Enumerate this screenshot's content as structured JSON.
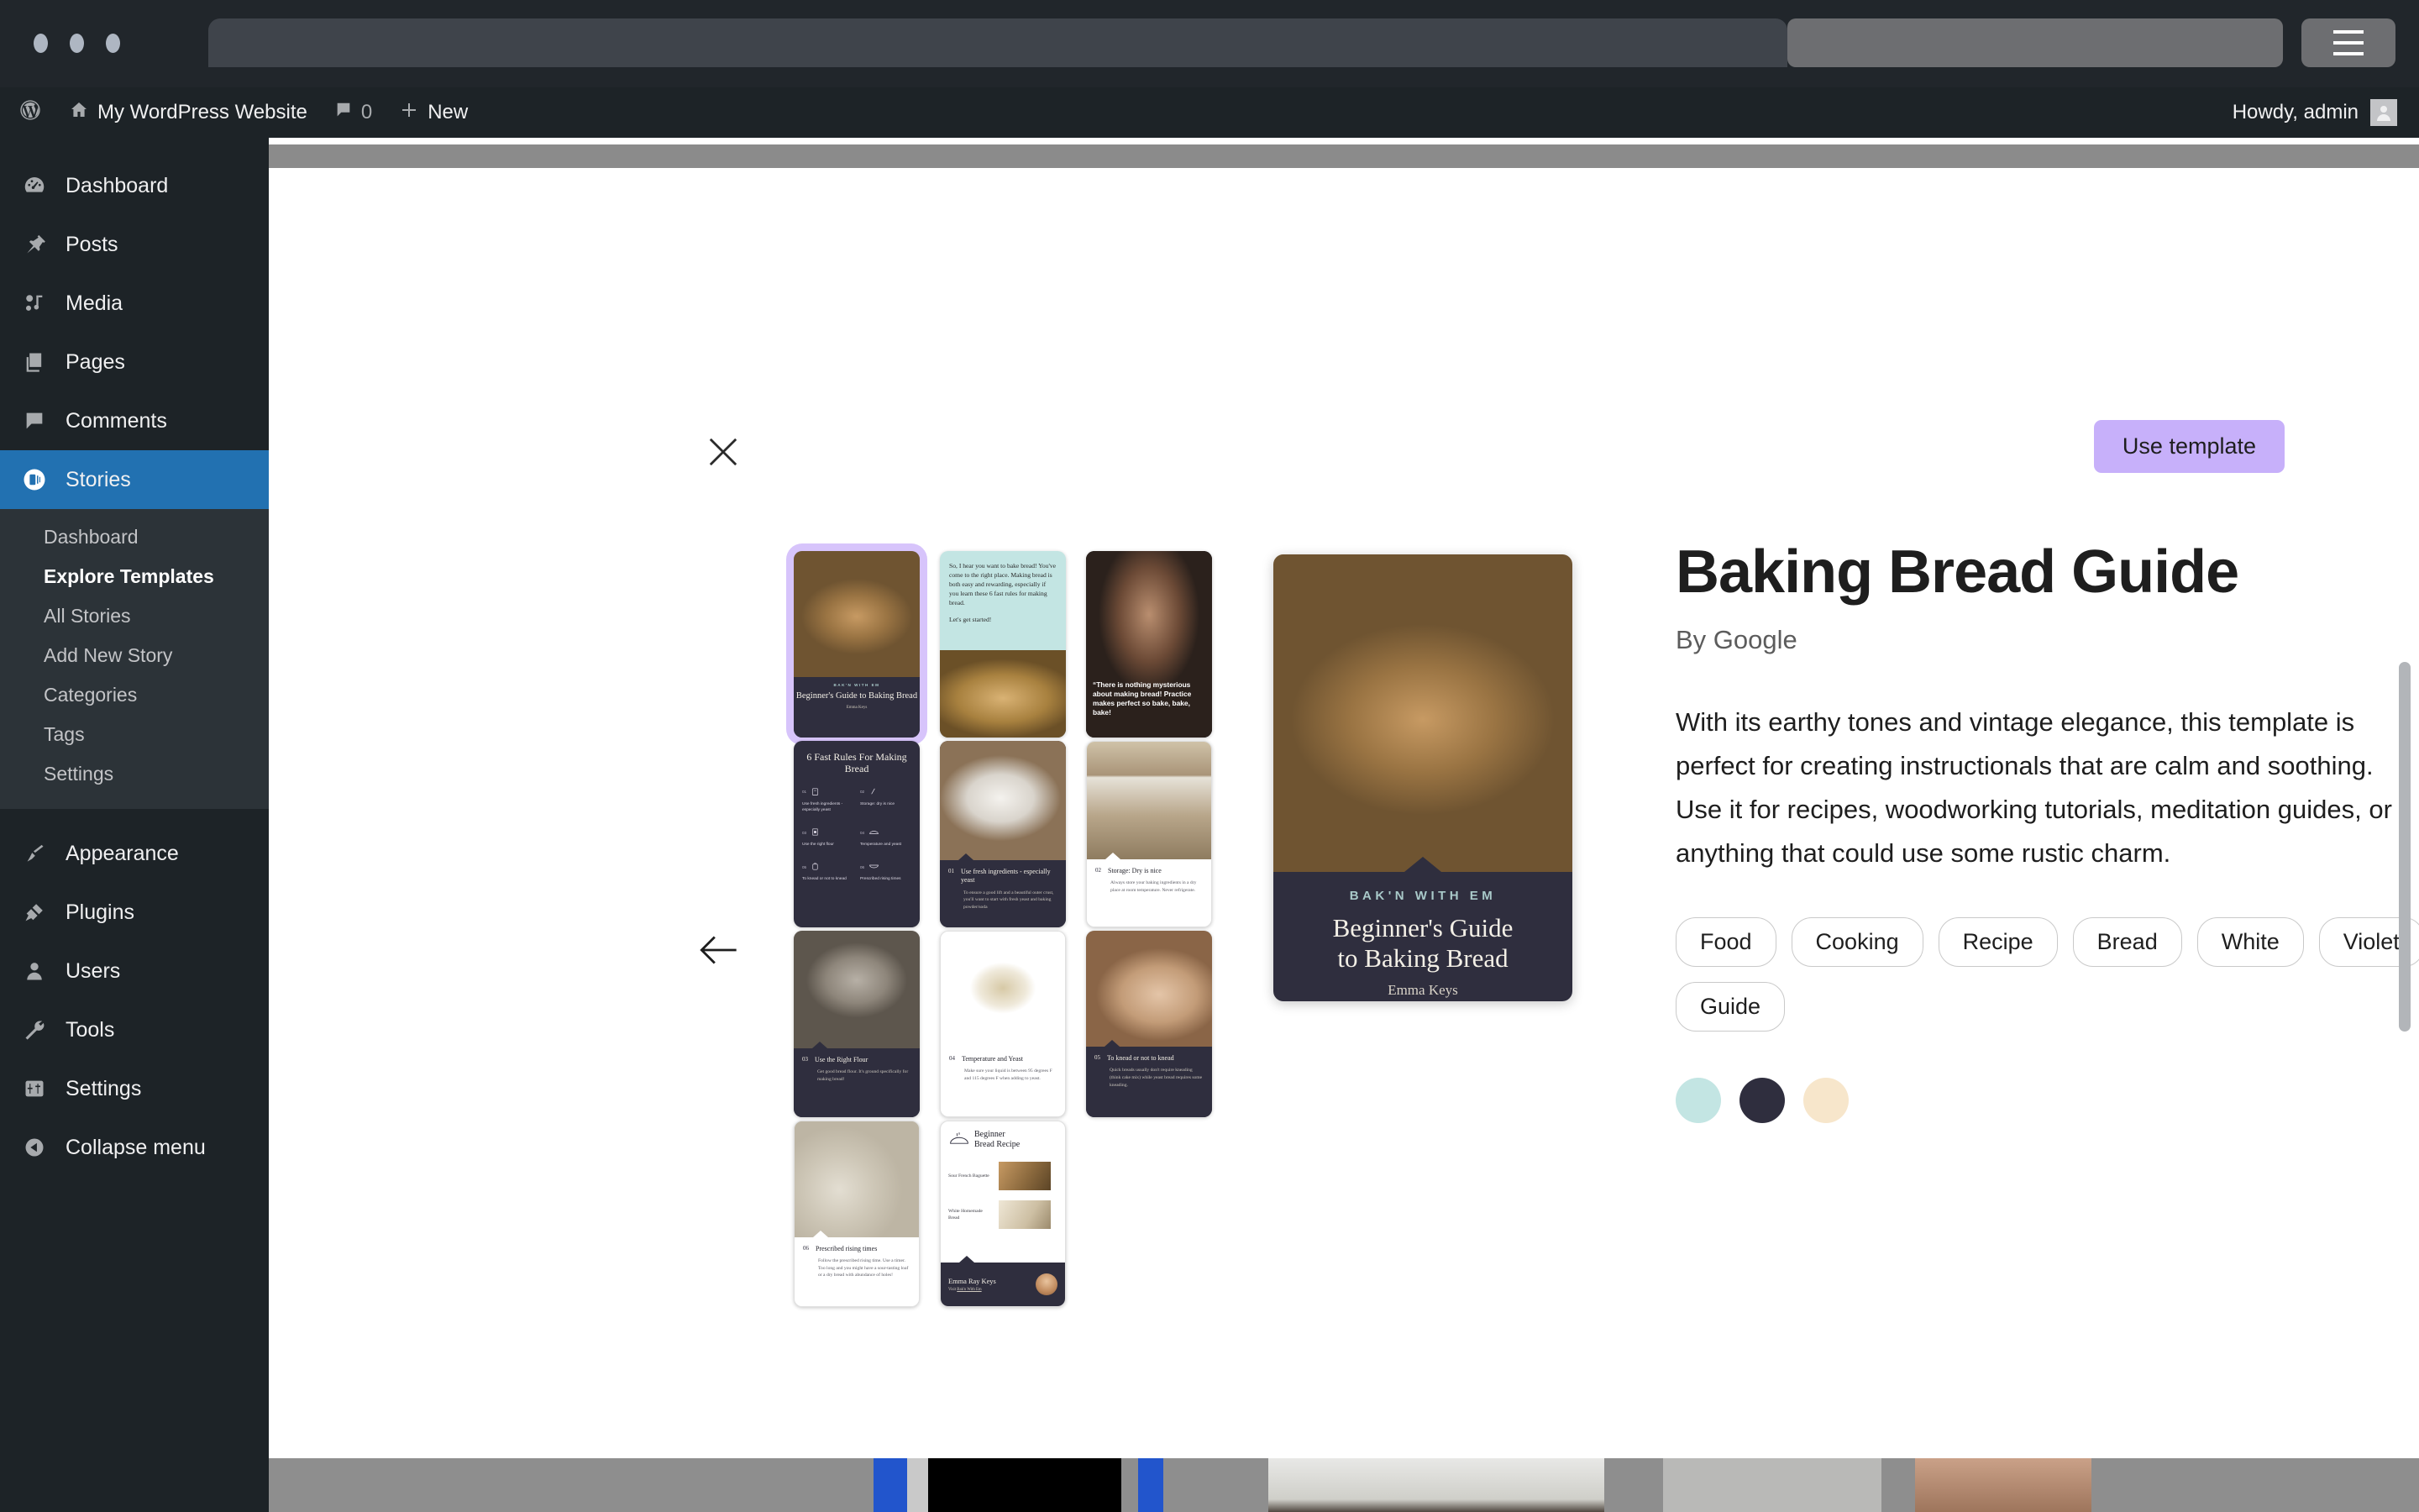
{
  "browser": {
    "traffic_lights": [
      "close",
      "minimize",
      "maximize"
    ],
    "url_value": "",
    "url_placeholder": "",
    "search_value": "",
    "menu_icon": "hamburger-icon"
  },
  "adminbar": {
    "logo": "wordpress-logo-icon",
    "site_icon": "home-icon",
    "site_name": "My WordPress Website",
    "comments_icon": "comment-bubble-icon",
    "comments_count": "0",
    "new_icon": "plus-icon",
    "new_label": "New",
    "howdy": "Howdy, admin",
    "avatar": "user-avatar-icon"
  },
  "sidebar": {
    "items": [
      {
        "label": "Dashboard",
        "icon": "dashboard-icon",
        "current": false
      },
      {
        "label": "Posts",
        "icon": "pin-icon",
        "current": false
      },
      {
        "label": "Media",
        "icon": "media-icon",
        "current": false
      },
      {
        "label": "Pages",
        "icon": "pages-icon",
        "current": false
      },
      {
        "label": "Comments",
        "icon": "comment-icon",
        "current": false
      },
      {
        "label": "Stories",
        "icon": "stories-icon",
        "current": true
      }
    ],
    "submenu": [
      {
        "label": "Dashboard",
        "active": false
      },
      {
        "label": "Explore Templates",
        "active": true
      },
      {
        "label": "All Stories",
        "active": false
      },
      {
        "label": "Add New Story",
        "active": false
      },
      {
        "label": "Categories",
        "active": false
      },
      {
        "label": "Tags",
        "active": false
      },
      {
        "label": "Settings",
        "active": false
      }
    ],
    "items_bottom": [
      {
        "label": "Appearance",
        "icon": "paintbrush-icon"
      },
      {
        "label": "Plugins",
        "icon": "plug-icon"
      },
      {
        "label": "Users",
        "icon": "user-icon"
      },
      {
        "label": "Tools",
        "icon": "wrench-icon"
      },
      {
        "label": "Settings",
        "icon": "settings-sliders-icon"
      },
      {
        "label": "Collapse menu",
        "icon": "collapse-arrow-icon"
      }
    ]
  },
  "modal": {
    "close_icon": "close-x-icon",
    "use_template_label": "Use template",
    "prev_icon": "arrow-left-icon",
    "next_icon": "arrow-right-icon",
    "accent_color": "#c7b0fa"
  },
  "template": {
    "title": "Baking Bread Guide",
    "byline": "By Google",
    "description": "With its earthy tones and vintage elegance, this template is perfect for creating instructionals that are calm and soothing. Use it for recipes, woodworking tutorials, meditation guides, or anything that could use some rustic charm.",
    "tags": [
      "Food",
      "Cooking",
      "Recipe",
      "Bread",
      "White",
      "Violet",
      "Guide"
    ],
    "colors": [
      "#c3e5e3",
      "#2f2e3e",
      "#f7e6cb"
    ]
  },
  "hero": {
    "brand": "BAK'N WITH EM",
    "title_line1": "Beginner's Guide",
    "title_line2": "to Baking Bread",
    "author": "Emma Keys"
  },
  "pages": [
    {
      "id": 1,
      "kind": "cover",
      "selected": true,
      "photo": "ph-bread1",
      "brand": "BAK'N WITH EM",
      "title": "Beginner's Guide to Baking Bread",
      "author": "Emma Keys"
    },
    {
      "id": 2,
      "kind": "intro",
      "selected": false,
      "photo": "ph-bread2",
      "body": "So, I hear you want to bake bread! You've come to the right place. Making bread is both easy and rewarding, especially if you learn these 6 fast rules for making bread.",
      "cta": "Let's get started!"
    },
    {
      "id": 3,
      "kind": "quote",
      "selected": false,
      "photo": "ph-portrait",
      "quote": "“There is nothing mysterious about making bread! Practice makes perfect so bake, bake, bake!"
    },
    {
      "id": 4,
      "kind": "rules-list",
      "selected": false,
      "title": "6 Fast Rules For Making Bread",
      "rules": [
        {
          "num": "01",
          "text": "Use fresh ingredients - especially yeast",
          "icon": "flour-bag-icon"
        },
        {
          "num": "02",
          "text": "Storage: dry is nice",
          "icon": "thermometer-icon"
        },
        {
          "num": "03",
          "text": "Use the right flour",
          "icon": "canister-icon"
        },
        {
          "num": "04",
          "text": "Temperature and yeast",
          "icon": "loaf-icon"
        },
        {
          "num": "05",
          "text": "To knead or not to knead",
          "icon": "jar-icon"
        },
        {
          "num": "06",
          "text": "Prescribed rising times",
          "icon": "bowl-icon"
        }
      ]
    },
    {
      "id": 5,
      "kind": "step",
      "selected": false,
      "photo": "ph-flour",
      "dark": true,
      "num": "01",
      "title": "Use fresh ingredients - especially yeast",
      "body": "To ensure a good lift and a beautiful outer crust, you'll want to start with fresh yeast and baking powder/soda"
    },
    {
      "id": 6,
      "kind": "step",
      "selected": false,
      "photo": "ph-jars",
      "dark": false,
      "num": "02",
      "title": "Storage: Dry is nice",
      "body": "Always store your baking ingredients in a dry place at room temperature. Never refrigerate."
    },
    {
      "id": 7,
      "kind": "step",
      "selected": false,
      "photo": "ph-sack",
      "dark": true,
      "num": "03",
      "title": "Use the Right Flour",
      "body": "Get good bread flour. It's ground specifically for making bread!"
    },
    {
      "id": 8,
      "kind": "step",
      "selected": false,
      "photo": "ph-bowl",
      "dark": false,
      "num": "04",
      "title": "Temperature and Yeast",
      "body": "Make sure your liquid is between 95 degrees F and 115 degrees F when adding to yeast."
    },
    {
      "id": 9,
      "kind": "step",
      "selected": false,
      "photo": "ph-knead",
      "dark": true,
      "num": "05",
      "title": "To knead or not to knead",
      "body": "Quick breads usually don't require kneading (think cake mix) while yeast bread requires some kneading."
    },
    {
      "id": 10,
      "kind": "step",
      "selected": false,
      "photo": "ph-dough",
      "dark": false,
      "num": "06",
      "title": "Prescribed rising times",
      "body": "Follow the prescribed rising time. Use a timer. Too long and you might have a sour-tasting loaf or a dry bread with abundance of holes!"
    },
    {
      "id": 11,
      "kind": "recipe",
      "selected": false,
      "title_line1": "Beginner",
      "title_line2": "Bread Recipe",
      "items": [
        {
          "label": "Sour French Baguette",
          "photo": "ph-baguette"
        },
        {
          "label": "White Homemade Bread",
          "photo": "ph-whitebread"
        }
      ],
      "author": "Emma Ray Keys",
      "visit_prefix": "Visit",
      "visit_link": "Bak'n With Em"
    }
  ]
}
